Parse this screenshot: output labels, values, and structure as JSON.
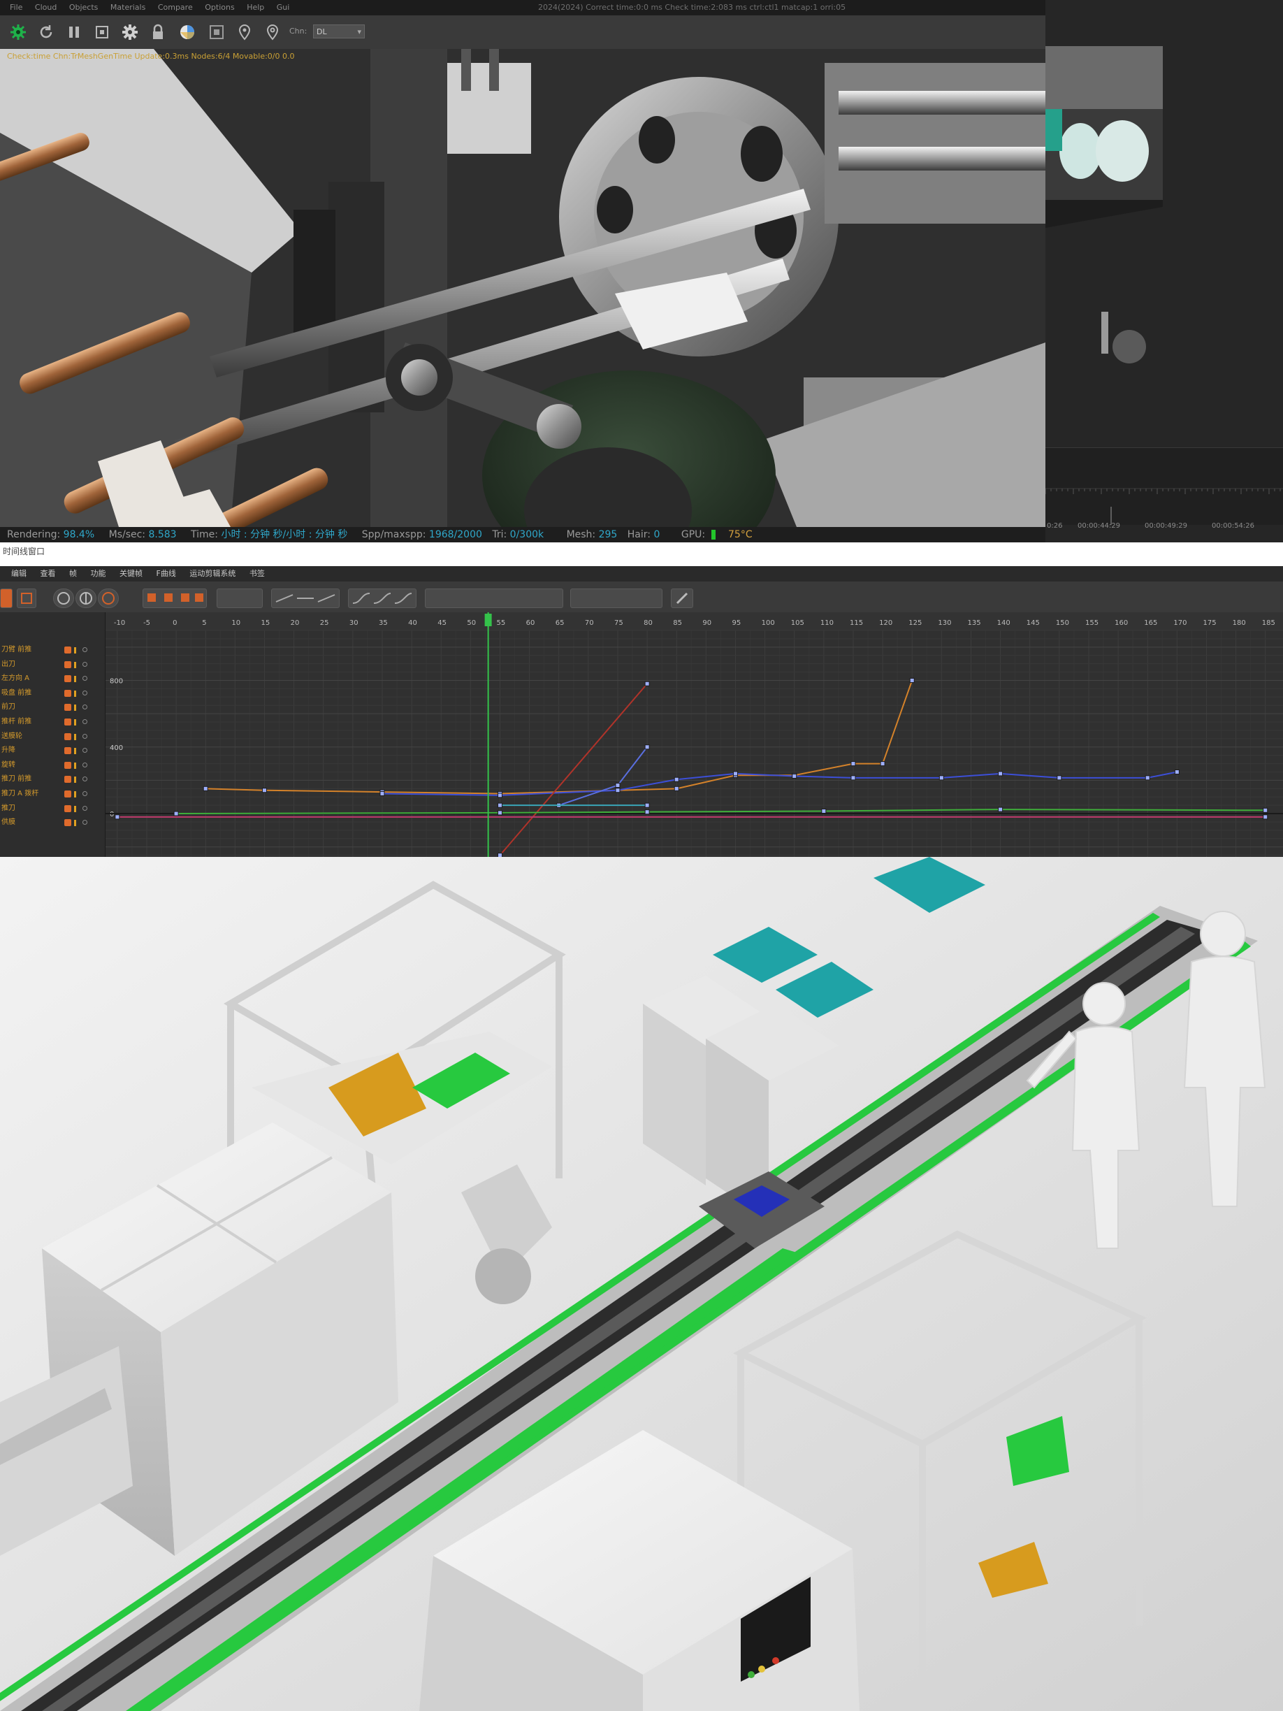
{
  "renderer": {
    "menu": [
      "File",
      "Cloud",
      "Objects",
      "Materials",
      "Compare",
      "Options",
      "Help",
      "Gui"
    ],
    "window_stats": "2024(2024) Correct time:0:0 ms  Check time:2:083 ms  ctrl:ctl1  matcap:1  orri:05",
    "channel_label": "Chn:",
    "channel_value": "DL",
    "status_line": "Check:time  Chn:TrMeshGenTime  Update:0.3ms  Nodes:6/4 Movable:0/0 0.0",
    "footer": {
      "rendering_label": "Rendering:",
      "rendering_value": "98.4%",
      "ms_label": "Ms/sec:",
      "ms_value": "8.583",
      "time_label": "Time:",
      "time_value": "小时 : 分钟 秒/小时 : 分钟 秒",
      "spp_label": "Spp/maxspp:",
      "spp_value": "1968/2000",
      "tri_label": "Tri:",
      "tri_value": "0/300k",
      "mesh_label": "Mesh:",
      "mesh_value": "295",
      "hair_label": "Hair:",
      "hair_value": "0",
      "gpu_label": "GPU:",
      "gpu_temp": "75°C"
    },
    "timecodes": [
      "0:26",
      "00:00:44:29",
      "00:00:49:29",
      "00:00:54:26"
    ]
  },
  "graph_editor": {
    "title": "时间线窗口",
    "menu": [
      "编辑",
      "查看",
      "帧",
      "功能",
      "关键帧",
      "F曲线",
      "运动剪辑系统",
      "书签"
    ],
    "tracks": [
      "刀臂 前推",
      "出刀",
      "左方向 A",
      "吸盘 前推",
      "前刀",
      "推杆 前推",
      "送膜轮",
      "升降",
      "旋转",
      "推刀 前推",
      "推刀 A 拨杆",
      "推刀",
      "供膜"
    ],
    "x_ticks": [
      "-10",
      "-5",
      "0",
      "5",
      "10",
      "15",
      "20",
      "25",
      "30",
      "35",
      "40",
      "45",
      "50",
      "55",
      "60",
      "65",
      "70",
      "75",
      "80",
      "85",
      "90",
      "95",
      "100",
      "105",
      "110",
      "115",
      "120",
      "125",
      "130",
      "135",
      "140",
      "145",
      "150",
      "155",
      "160",
      "165",
      "170",
      "175",
      "180",
      "185"
    ],
    "y_ticks": [
      "800",
      "400",
      "0"
    ],
    "current_frame": "53",
    "colors": {
      "orange": "#d4822a",
      "blue": "#3c4fd8",
      "red": "#b0332a",
      "green": "#3fae3a",
      "magenta": "#c0396b",
      "cyan": "#3aa6b8",
      "playhead": "#34c24a"
    }
  },
  "chart_data": {
    "type": "line",
    "xlabel": "",
    "ylabel": "",
    "xlim": [
      -12,
      188
    ],
    "ylim": [
      -260,
      1100
    ],
    "series": [
      {
        "color": "#d4822a",
        "x": [
          5,
          15,
          35,
          55,
          75,
          85,
          95,
          105,
          115,
          120,
          125
        ],
        "y": [
          150,
          140,
          130,
          120,
          140,
          150,
          230,
          230,
          300,
          300,
          800
        ]
      },
      {
        "color": "#3c4fd8",
        "x": [
          35,
          55,
          75,
          85,
          95,
          105,
          115,
          130,
          140,
          150,
          165,
          170
        ],
        "y": [
          120,
          110,
          140,
          205,
          240,
          225,
          215,
          215,
          240,
          215,
          215,
          250
        ]
      },
      {
        "color": "#b0332a",
        "x": [
          55,
          80
        ],
        "y": [
          -250,
          780
        ]
      },
      {
        "color": "#5a6fe0",
        "x": [
          65,
          75,
          80
        ],
        "y": [
          50,
          170,
          400
        ]
      },
      {
        "color": "#3fae3a",
        "x": [
          0,
          55,
          80,
          110,
          140,
          185
        ],
        "y": [
          0,
          5,
          10,
          15,
          25,
          20
        ]
      },
      {
        "color": "#c0396b",
        "x": [
          -10,
          185
        ],
        "y": [
          -20,
          -20
        ]
      },
      {
        "color": "#3aa6b8",
        "x": [
          55,
          80
        ],
        "y": [
          50,
          50
        ]
      }
    ]
  },
  "production_line": {
    "accent_green": "#27c93f",
    "tray_teal": "#1fa3a6",
    "part_gold": "#d79b1e",
    "part_blue": "#2430b8"
  }
}
